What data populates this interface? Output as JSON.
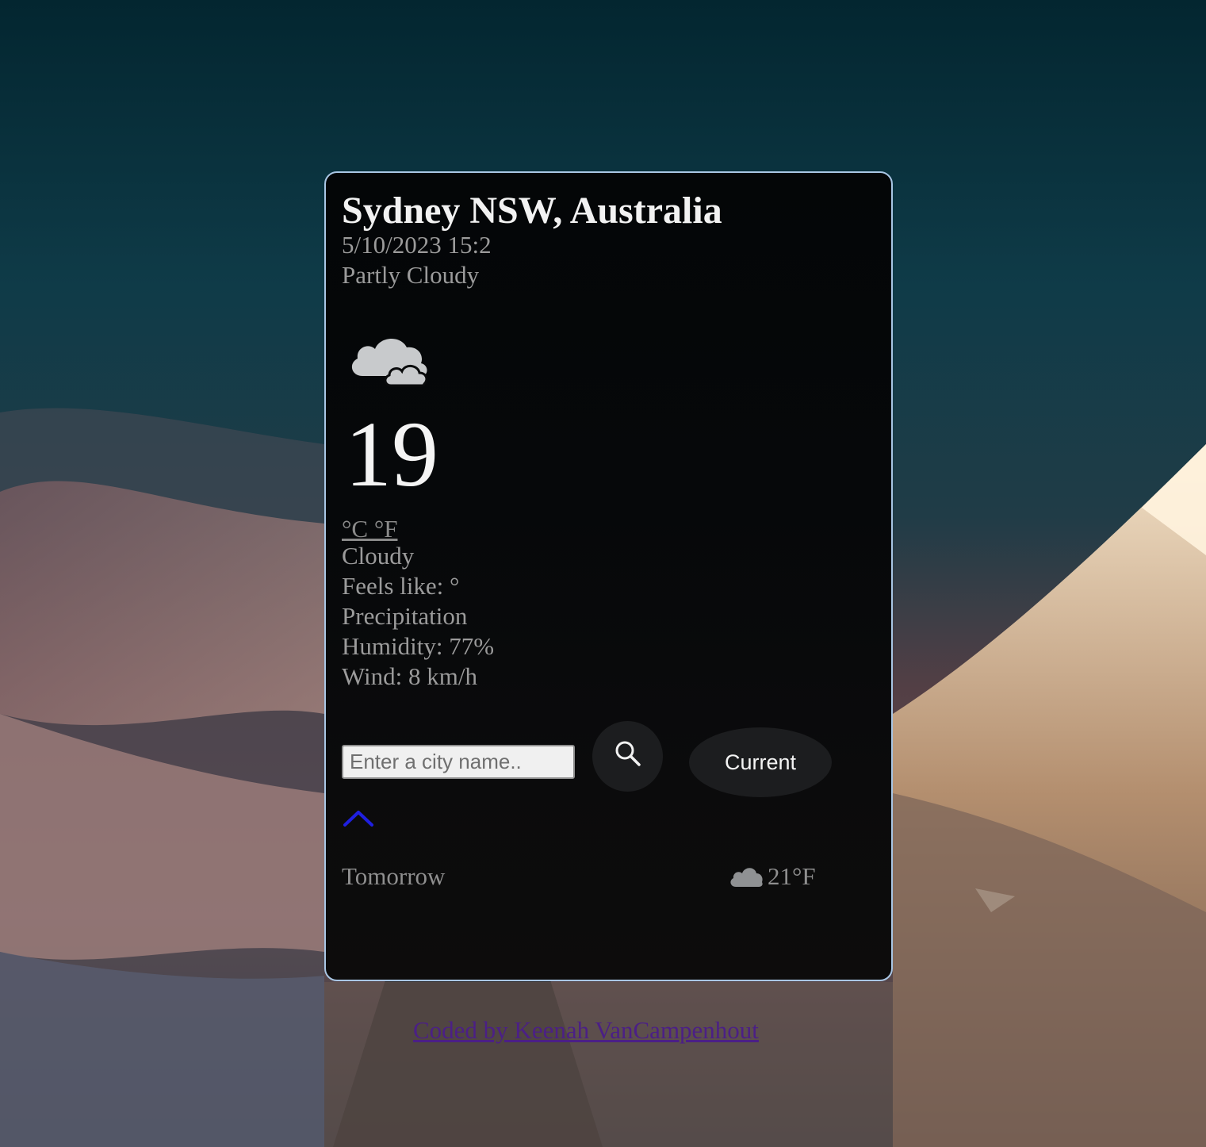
{
  "weather": {
    "city": "Sydney NSW, Australia",
    "datetime": "5/10/2023 15:2",
    "description": "Partly Cloudy",
    "main_icon": "cloudy-icon",
    "temperature": "19",
    "units": "°C °F",
    "condition": "Cloudy",
    "feels_like": "Feels like: °",
    "precipitation": "Precipitation",
    "humidity": "Humidity: 77%",
    "wind": "Wind: 8 km/h"
  },
  "search": {
    "placeholder": "Enter a city name..",
    "search_icon": "search-icon",
    "current_label": "Current"
  },
  "forecast": {
    "toggle_icon": "chevron-up-icon",
    "day": "Tomorrow",
    "icon": "cloud-icon",
    "temperature": "21°F"
  },
  "footer": {
    "credit": "Coded by Keenah VanCampenhout"
  },
  "colors": {
    "card_border": "#a9c6e4",
    "chevron": "#1f1fe0",
    "link_visited": "#4b1f86",
    "button_bg": "#1c1d1f"
  }
}
